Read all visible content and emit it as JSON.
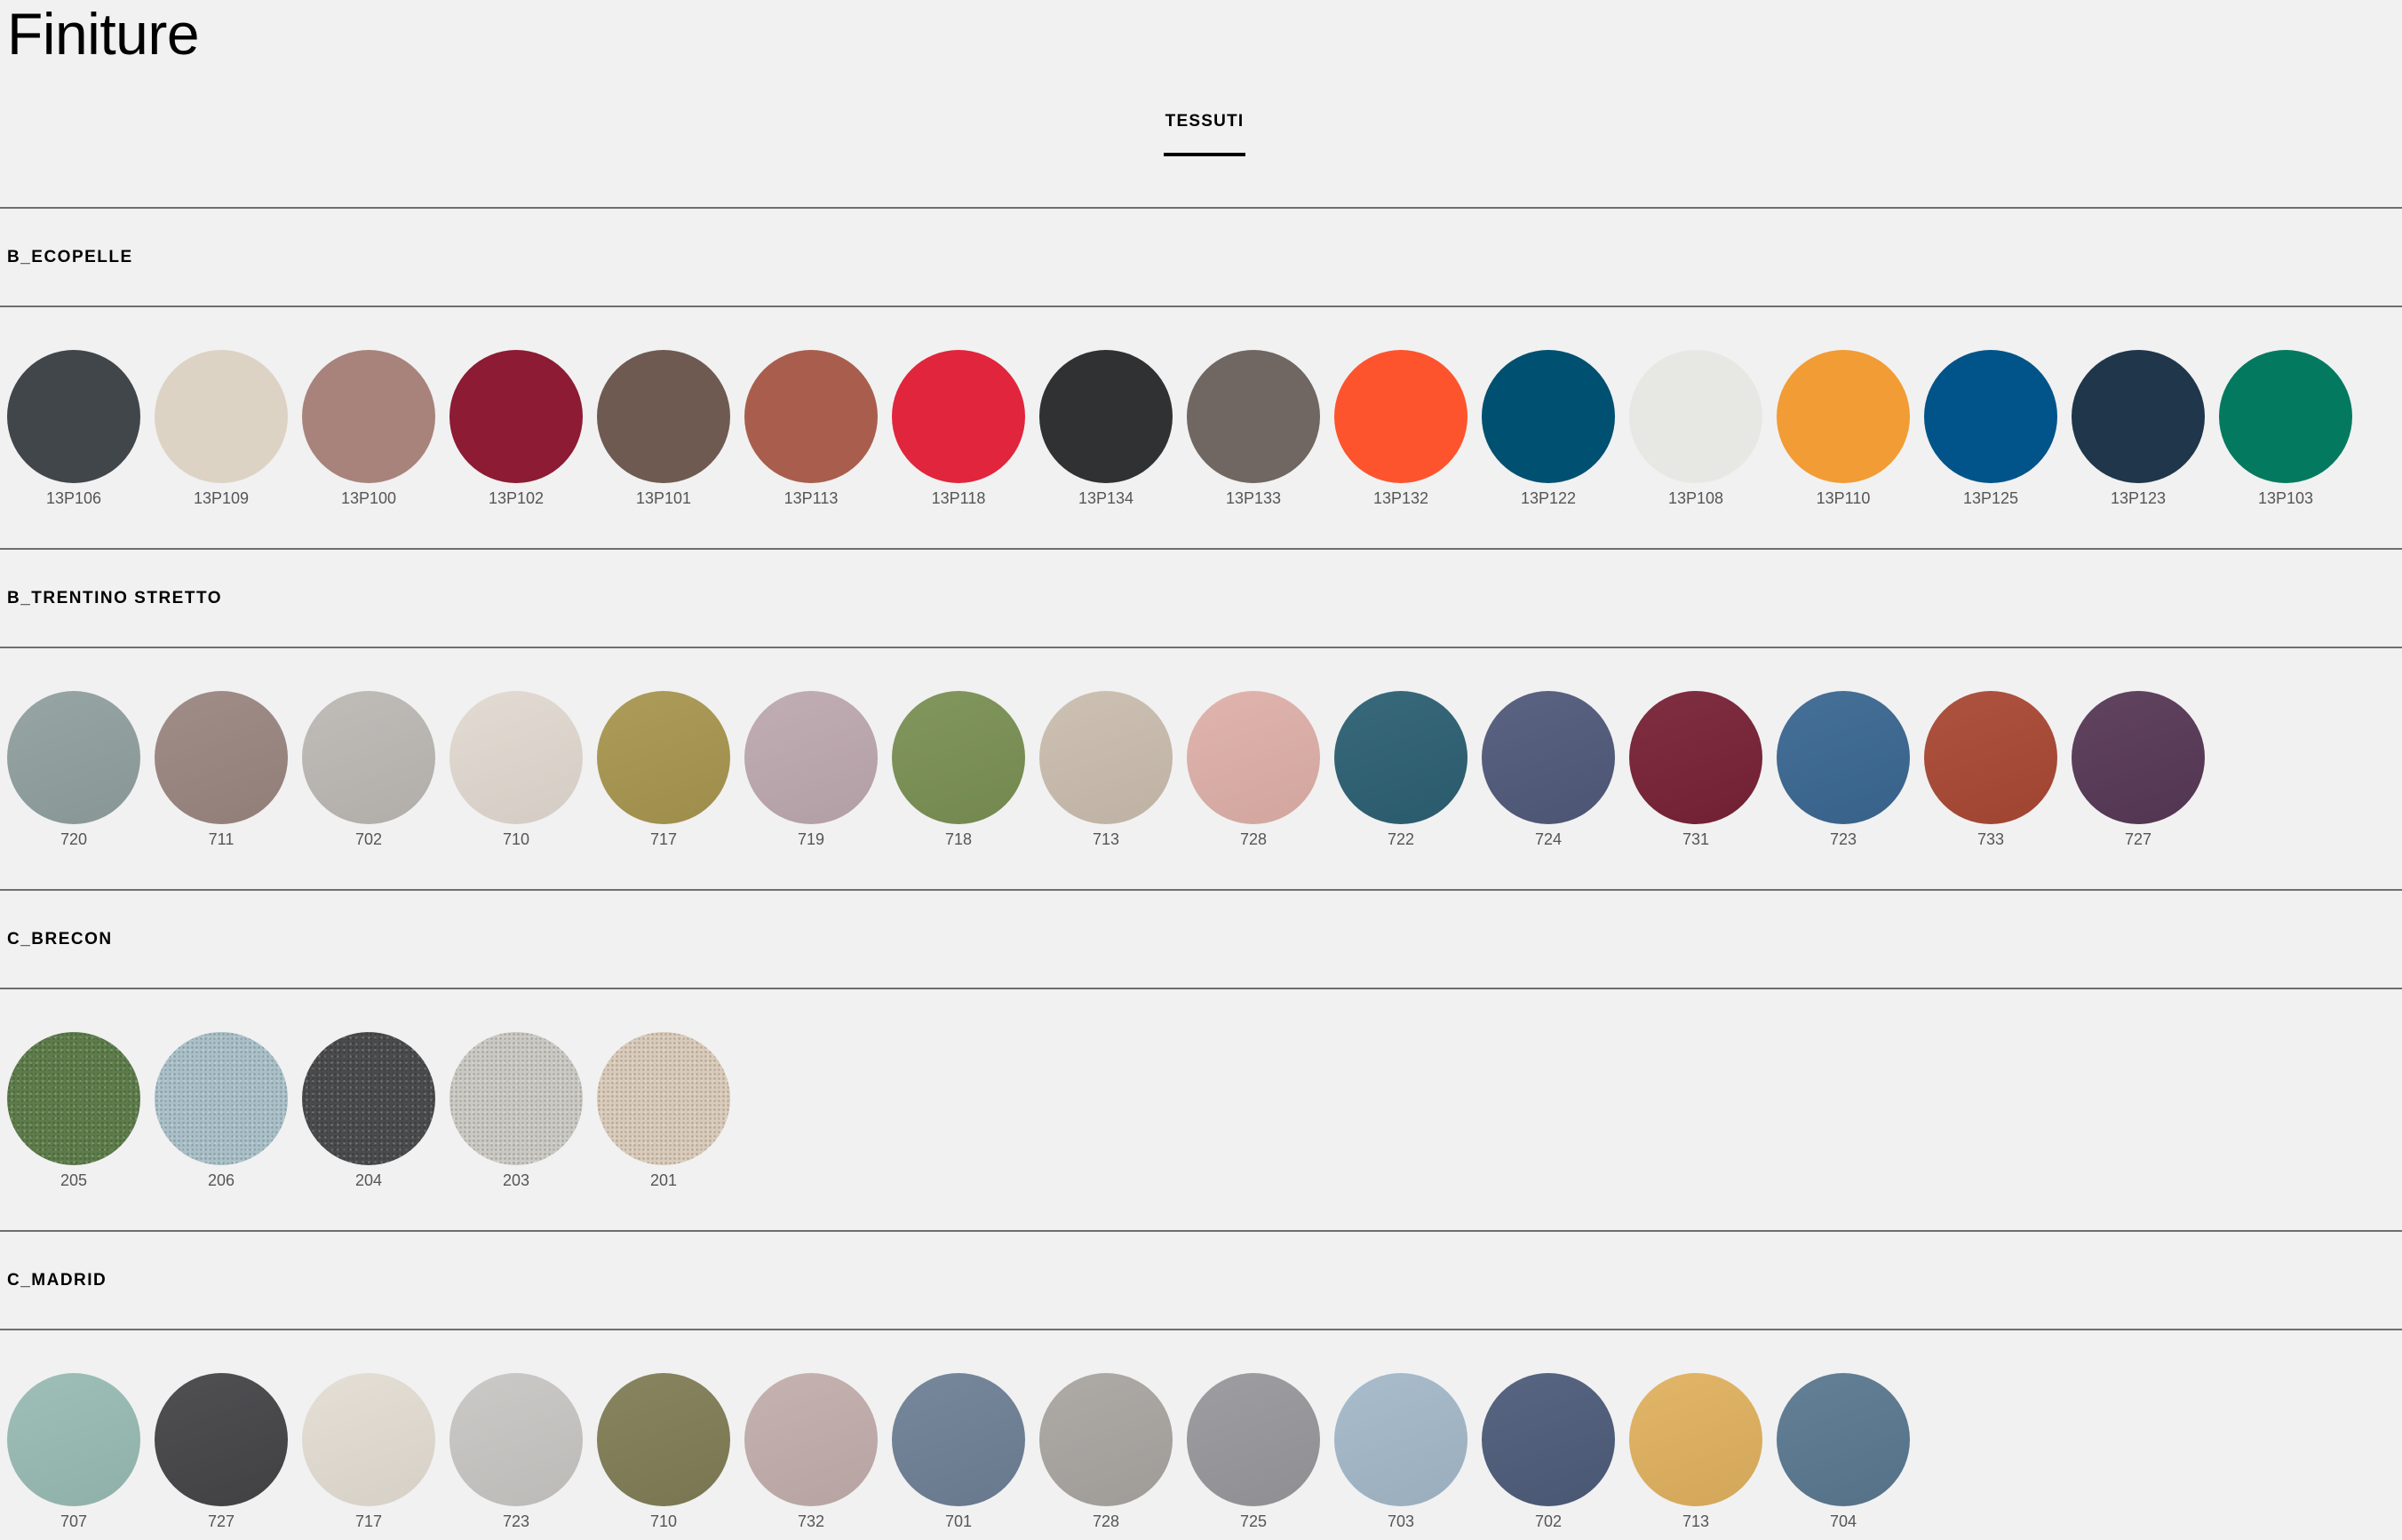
{
  "page": {
    "title": "Finiture"
  },
  "tabs": [
    {
      "label": "TESSUTI"
    }
  ],
  "categories": [
    {
      "name": "B_ECOPELLE",
      "finish": "solid",
      "swatches": [
        {
          "code": "13P106",
          "color": "#41464b"
        },
        {
          "code": "13P109",
          "color": "#ddd3c5"
        },
        {
          "code": "13P100",
          "color": "#a8837b"
        },
        {
          "code": "13P102",
          "color": "#8c1b33"
        },
        {
          "code": "13P101",
          "color": "#6f5a51"
        },
        {
          "code": "13P113",
          "color": "#a95e4d"
        },
        {
          "code": "13P118",
          "color": "#e1253c"
        },
        {
          "code": "13P134",
          "color": "#303133"
        },
        {
          "code": "13P133",
          "color": "#706662"
        },
        {
          "code": "13P132",
          "color": "#fd542d"
        },
        {
          "code": "13P122",
          "color": "#005071"
        },
        {
          "code": "13P108",
          "color": "#e7e7e4"
        },
        {
          "code": "13P110",
          "color": "#f29c35"
        },
        {
          "code": "13P125",
          "color": "#00548a"
        },
        {
          "code": "13P123",
          "color": "#1f364b"
        },
        {
          "code": "13P103",
          "color": "#037a5f"
        }
      ]
    },
    {
      "name": "B_TRENTINO STRETTO",
      "finish": "soft",
      "swatches": [
        {
          "code": "720",
          "color": "#90a09f"
        },
        {
          "code": "711",
          "color": "#9b8680"
        },
        {
          "code": "702",
          "color": "#bcb8b4"
        },
        {
          "code": "710",
          "color": "#e1d9d0"
        },
        {
          "code": "717",
          "color": "#a8964f"
        },
        {
          "code": "719",
          "color": "#bda8af"
        },
        {
          "code": "718",
          "color": "#7a9054"
        },
        {
          "code": "713",
          "color": "#cabdae"
        },
        {
          "code": "728",
          "color": "#deb0a8"
        },
        {
          "code": "722",
          "color": "#2c6073"
        },
        {
          "code": "724",
          "color": "#505a7a"
        },
        {
          "code": "731",
          "color": "#772235"
        },
        {
          "code": "723",
          "color": "#3a6791"
        },
        {
          "code": "733",
          "color": "#a94834"
        },
        {
          "code": "727",
          "color": "#573856"
        }
      ]
    },
    {
      "name": "C_BRECON",
      "finish": "textured",
      "swatches": [
        {
          "code": "205",
          "color": "#5d7c4a"
        },
        {
          "code": "206",
          "color": "#a9c0c8"
        },
        {
          "code": "204",
          "color": "#4a4b4c"
        },
        {
          "code": "203",
          "color": "#cac9c3"
        },
        {
          "code": "201",
          "color": "#d9cab9"
        }
      ]
    },
    {
      "name": "C_MADRID",
      "finish": "soft",
      "swatches": [
        {
          "code": "707",
          "color": "#98bbb3"
        },
        {
          "code": "727",
          "color": "#454548"
        },
        {
          "code": "717",
          "color": "#e3ddd3"
        },
        {
          "code": "723",
          "color": "#c8c6c3"
        },
        {
          "code": "710",
          "color": "#807d56"
        },
        {
          "code": "732",
          "color": "#c2aeac"
        },
        {
          "code": "701",
          "color": "#6e8096"
        },
        {
          "code": "728",
          "color": "#a9a5a1"
        },
        {
          "code": "725",
          "color": "#98979b"
        },
        {
          "code": "703",
          "color": "#a3b8c9"
        },
        {
          "code": "702",
          "color": "#4d5c7a"
        },
        {
          "code": "713",
          "color": "#e0b15f"
        },
        {
          "code": "704",
          "color": "#5a7890"
        }
      ]
    }
  ]
}
